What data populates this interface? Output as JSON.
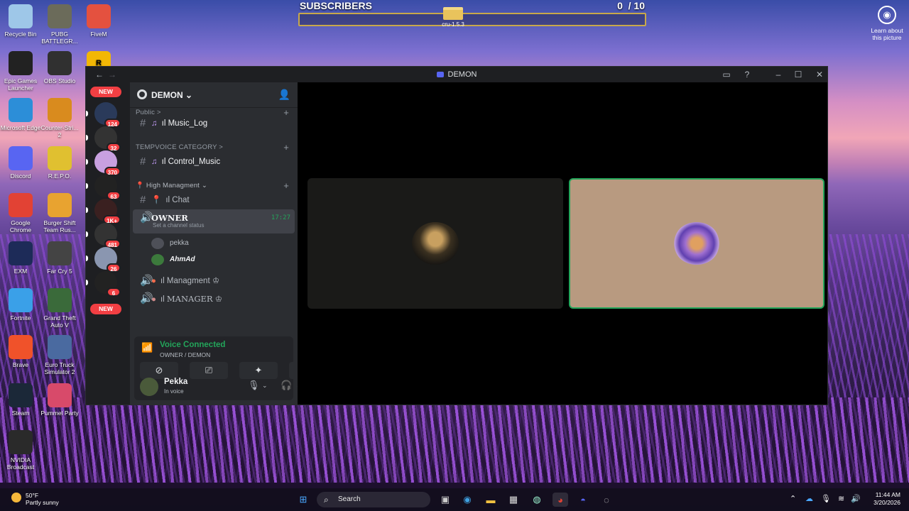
{
  "desktop": {
    "icons": [
      {
        "label": "Recycle Bin",
        "icon": "recycle-bin-icon",
        "color": "#9ec7e8"
      },
      {
        "label": "PUBG BATTLEGR...",
        "icon": "pubg-icon",
        "color": "#6b6b5a"
      },
      {
        "label": "FiveM",
        "icon": "fivem-icon",
        "color": "#e4513f"
      },
      {
        "label": "Epic Games Launcher",
        "icon": "epic-games-icon",
        "color": "#222"
      },
      {
        "label": "OBS Studio",
        "icon": "obs-icon",
        "color": "#303030"
      },
      {
        "label": "Microsoft Edge",
        "icon": "edge-icon",
        "color": "#2c8ed8"
      },
      {
        "label": "Counter-Stri... 2",
        "icon": "counter-strike-icon",
        "color": "#d98b1e"
      },
      {
        "label": "Discord",
        "icon": "discord-icon",
        "color": "#5865f2"
      },
      {
        "label": "R.E.P.O.",
        "icon": "repo-icon",
        "color": "#e0c030"
      },
      {
        "label": "Google Chrome",
        "icon": "chrome-icon",
        "color": "#e24234"
      },
      {
        "label": "Burger Shift Team Rus...",
        "icon": "burger-shift-icon",
        "color": "#e8a330"
      },
      {
        "label": "EXM",
        "icon": "exm-icon",
        "color": "#1d2b58"
      },
      {
        "label": "Far Cry 5",
        "icon": "far-cry-icon",
        "color": "#444"
      },
      {
        "label": "Fortnite",
        "icon": "fortnite-icon",
        "color": "#3aa0e8"
      },
      {
        "label": "Grand Theft Auto V",
        "icon": "gta-icon",
        "color": "#3a6a3a"
      },
      {
        "label": "Brave",
        "icon": "brave-icon",
        "color": "#f0522a"
      },
      {
        "label": "Euro Truck Simulator 2",
        "icon": "ets2-icon",
        "color": "#4a6aa0"
      },
      {
        "label": "Steam",
        "icon": "steam-icon",
        "color": "#1b2838"
      },
      {
        "label": "Pummel Party",
        "icon": "pummel-party-icon",
        "color": "#d84a6a"
      },
      {
        "label": "NVIDIA Broadcast",
        "icon": "nvidia-icon",
        "color": "#2a2a2a"
      }
    ],
    "learn_label": "Learn about this picture",
    "folder_label": "cru-1.5.3"
  },
  "subscribers": {
    "label": "SUBSCRIBERS",
    "count": "0",
    "goal": "/ 10",
    "progress": 0
  },
  "discord": {
    "window_title": "DEMON",
    "server_name": "DEMON",
    "server_badges": [
      "124",
      "32",
      "370",
      "63",
      "1K+",
      "481",
      "26",
      "6"
    ],
    "new_label": "NEW",
    "categories": [
      {
        "label": "Public >"
      },
      {
        "label": "TEMPVOICE CATEGORY >"
      },
      {
        "label": "High Managment ⌄"
      }
    ],
    "channels": {
      "music_log": "Music_Log",
      "control_music": "Control_Music",
      "chat": "Chat",
      "owner": "OWNER",
      "owner_time": "17:27",
      "owner_status": "Set a channel status",
      "managment": "Managment",
      "manager": "MANAGER"
    },
    "voice_users": [
      "pekka",
      "AhmAd"
    ],
    "voice_panel": {
      "status": "Voice Connected",
      "channel": "OWNER / DEMON"
    },
    "user": {
      "name": "Pekka",
      "status": "In voice"
    },
    "accent": "#23a55a"
  },
  "taskbar": {
    "weather_temp": "50°F",
    "weather_desc": "Partly sunny",
    "search_placeholder": "Search",
    "time": "11:44 AM",
    "date": "3/20/2026"
  }
}
